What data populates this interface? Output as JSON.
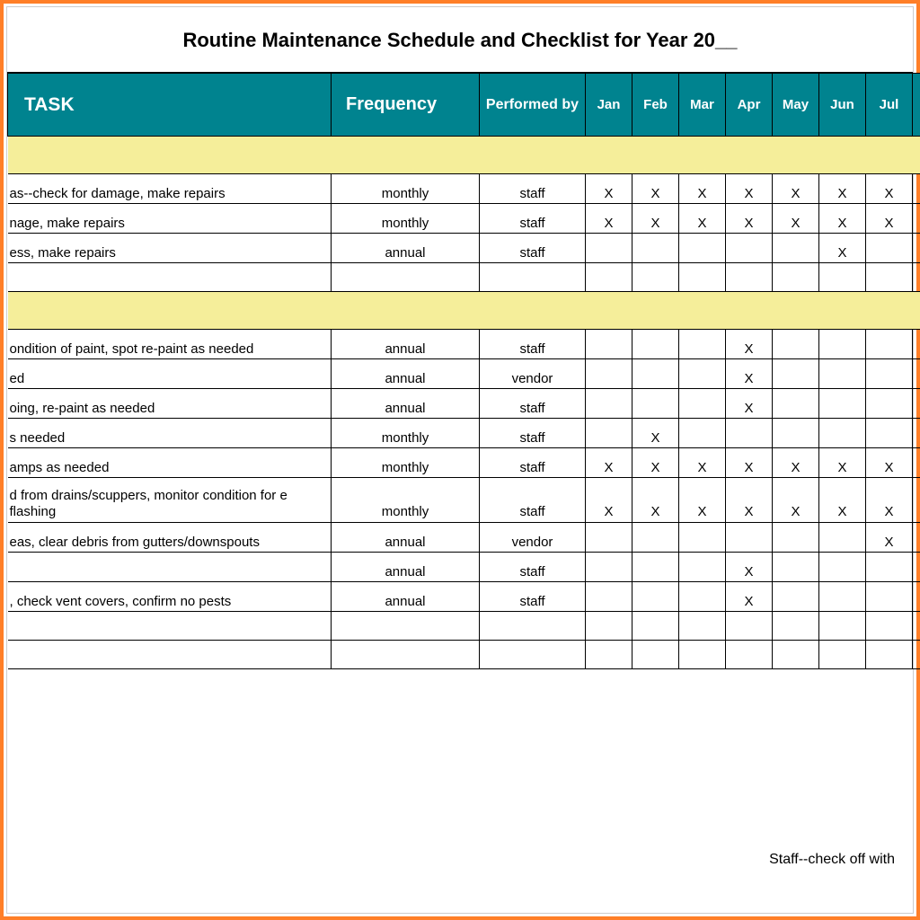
{
  "title": "Routine Maintenance Schedule and Checklist for Year 20__",
  "headers": {
    "task": "TASK",
    "frequency": "Frequency",
    "performed_by": "Performed by",
    "months": [
      "Jan",
      "Feb",
      "Mar",
      "Apr",
      "May",
      "Jun",
      "Jul",
      ""
    ]
  },
  "sections": [
    {
      "rows": [
        {
          "task": "as--check for damage, make repairs",
          "freq": "monthly",
          "perf": "staff",
          "marks": [
            "X",
            "X",
            "X",
            "X",
            "X",
            "X",
            "X",
            ""
          ]
        },
        {
          "task": "nage, make repairs",
          "freq": "monthly",
          "perf": "staff",
          "marks": [
            "X",
            "X",
            "X",
            "X",
            "X",
            "X",
            "X",
            ""
          ]
        },
        {
          "task": "ess, make repairs",
          "freq": "annual",
          "perf": "staff",
          "marks": [
            "",
            "",
            "",
            "",
            "",
            "X",
            "",
            ""
          ]
        }
      ],
      "empty_after": 1
    },
    {
      "rows": [
        {
          "task": "ondition of paint, spot re-paint as needed",
          "freq": "annual",
          "perf": "staff",
          "marks": [
            "",
            "",
            "",
            "X",
            "",
            "",
            "",
            ""
          ]
        },
        {
          "task": "ed",
          "freq": "annual",
          "perf": "vendor",
          "marks": [
            "",
            "",
            "",
            "X",
            "",
            "",
            "",
            ""
          ]
        },
        {
          "task": "oing, re-paint as needed",
          "freq": "annual",
          "perf": "staff",
          "marks": [
            "",
            "",
            "",
            "X",
            "",
            "",
            "",
            ""
          ]
        },
        {
          "task": "s needed",
          "freq": "monthly",
          "perf": "staff",
          "marks": [
            "",
            "X",
            "",
            "",
            "",
            "",
            "",
            ""
          ]
        },
        {
          "task": "amps as needed",
          "freq": "monthly",
          "perf": "staff",
          "marks": [
            "X",
            "X",
            "X",
            "X",
            "X",
            "X",
            "X",
            ""
          ]
        },
        {
          "task": "d from drains/scuppers, monitor condition for e flashing",
          "freq": "monthly",
          "perf": "staff",
          "marks": [
            "X",
            "X",
            "X",
            "X",
            "X",
            "X",
            "X",
            ""
          ],
          "tall": true
        },
        {
          "task": "eas, clear debris from gutters/downspouts",
          "freq": "annual",
          "perf": "vendor",
          "marks": [
            "",
            "",
            "",
            "",
            "",
            "",
            "X",
            ""
          ]
        },
        {
          "task": "",
          "freq": "annual",
          "perf": "staff",
          "marks": [
            "",
            "",
            "",
            "X",
            "",
            "",
            "",
            ""
          ]
        },
        {
          "task": ", check vent covers, confirm no pests",
          "freq": "annual",
          "perf": "staff",
          "marks": [
            "",
            "",
            "",
            "X",
            "",
            "",
            "",
            ""
          ]
        }
      ],
      "empty_after": 2
    }
  ],
  "footer": "Staff--check off with"
}
